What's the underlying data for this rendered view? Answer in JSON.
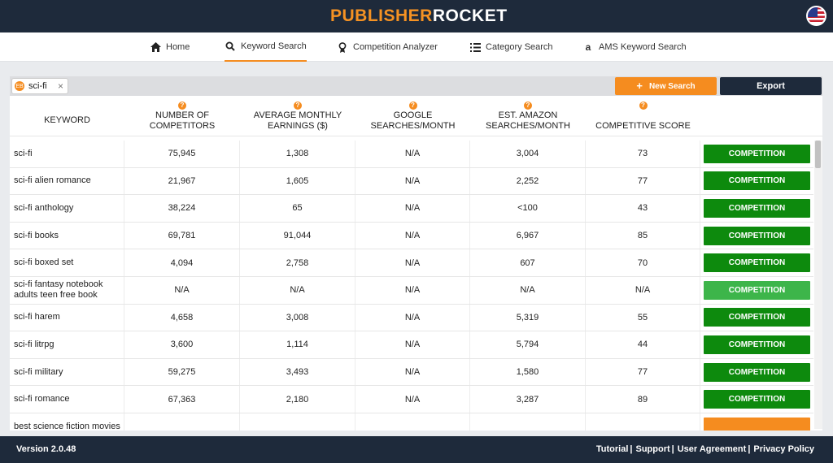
{
  "brand": {
    "logo_part1": "PUBLISHER",
    "logo_part2": "ROCKET"
  },
  "colors": {
    "accent": "#f58c1f",
    "navy": "#1e2a3b",
    "green_dark": "#0d8a0d",
    "green_light": "#3db54a",
    "orange": "#f58c1f"
  },
  "nav": {
    "tabs": [
      {
        "label": "Home",
        "icon": "home-icon"
      },
      {
        "label": "Keyword Search",
        "icon": "search-icon",
        "active": true
      },
      {
        "label": "Competition Analyzer",
        "icon": "medal-icon"
      },
      {
        "label": "Category Search",
        "icon": "list-icon"
      },
      {
        "label": "AMS Keyword Search",
        "icon": "amazon-icon"
      }
    ]
  },
  "search": {
    "chip_label": "sci-fi",
    "chip_icon": "EB",
    "new_search_label": "New Search",
    "export_label": "Export"
  },
  "table": {
    "headers": {
      "keyword": "KEYWORD",
      "competitors": "NUMBER OF COMPETITORS",
      "earnings": "AVERAGE MONTHLY EARNINGS ($)",
      "google": "GOOGLE SEARCHES/MONTH",
      "amazon": "EST. AMAZON SEARCHES/MONTH",
      "score": "COMPETITIVE SCORE",
      "help_icon": "?"
    },
    "rows": [
      {
        "keyword": "sci-fi",
        "competitors": "75,945",
        "earnings": "1,308",
        "google": "N/A",
        "amazon": "3,004",
        "score": "73",
        "button": "COMPETITION",
        "button_color": "dark"
      },
      {
        "keyword": "sci-fi alien romance",
        "competitors": "21,967",
        "earnings": "1,605",
        "google": "N/A",
        "amazon": "2,252",
        "score": "77",
        "button": "COMPETITION",
        "button_color": "dark"
      },
      {
        "keyword": "sci-fi anthology",
        "competitors": "38,224",
        "earnings": "65",
        "google": "N/A",
        "amazon": "<100",
        "score": "43",
        "button": "COMPETITION",
        "button_color": "dark"
      },
      {
        "keyword": "sci-fi books",
        "competitors": "69,781",
        "earnings": "91,044",
        "google": "N/A",
        "amazon": "6,967",
        "score": "85",
        "button": "COMPETITION",
        "button_color": "dark"
      },
      {
        "keyword": "sci-fi boxed set",
        "competitors": "4,094",
        "earnings": "2,758",
        "google": "N/A",
        "amazon": "607",
        "score": "70",
        "button": "COMPETITION",
        "button_color": "dark"
      },
      {
        "keyword": "sci-fi fantasy notebook adults teen free book",
        "competitors": "N/A",
        "earnings": "N/A",
        "google": "N/A",
        "amazon": "N/A",
        "score": "N/A",
        "button": "COMPETITION",
        "button_color": "light"
      },
      {
        "keyword": "sci-fi harem",
        "competitors": "4,658",
        "earnings": "3,008",
        "google": "N/A",
        "amazon": "5,319",
        "score": "55",
        "button": "COMPETITION",
        "button_color": "dark"
      },
      {
        "keyword": "sci-fi litrpg",
        "competitors": "3,600",
        "earnings": "1,114",
        "google": "N/A",
        "amazon": "5,794",
        "score": "44",
        "button": "COMPETITION",
        "button_color": "dark"
      },
      {
        "keyword": "sci-fi military",
        "competitors": "59,275",
        "earnings": "3,493",
        "google": "N/A",
        "amazon": "1,580",
        "score": "77",
        "button": "COMPETITION",
        "button_color": "dark"
      },
      {
        "keyword": "sci-fi romance",
        "competitors": "67,363",
        "earnings": "2,180",
        "google": "N/A",
        "amazon": "3,287",
        "score": "89",
        "button": "COMPETITION",
        "button_color": "dark"
      },
      {
        "keyword": "best science fiction movies",
        "competitors": "",
        "earnings": "",
        "google": "",
        "amazon": "",
        "score": "",
        "button": "",
        "button_color": "orange"
      }
    ]
  },
  "footer": {
    "version": "Version 2.0.48",
    "links": [
      "Tutorial",
      "Support",
      "User Agreement",
      "Privacy Policy"
    ],
    "separator": "|"
  }
}
